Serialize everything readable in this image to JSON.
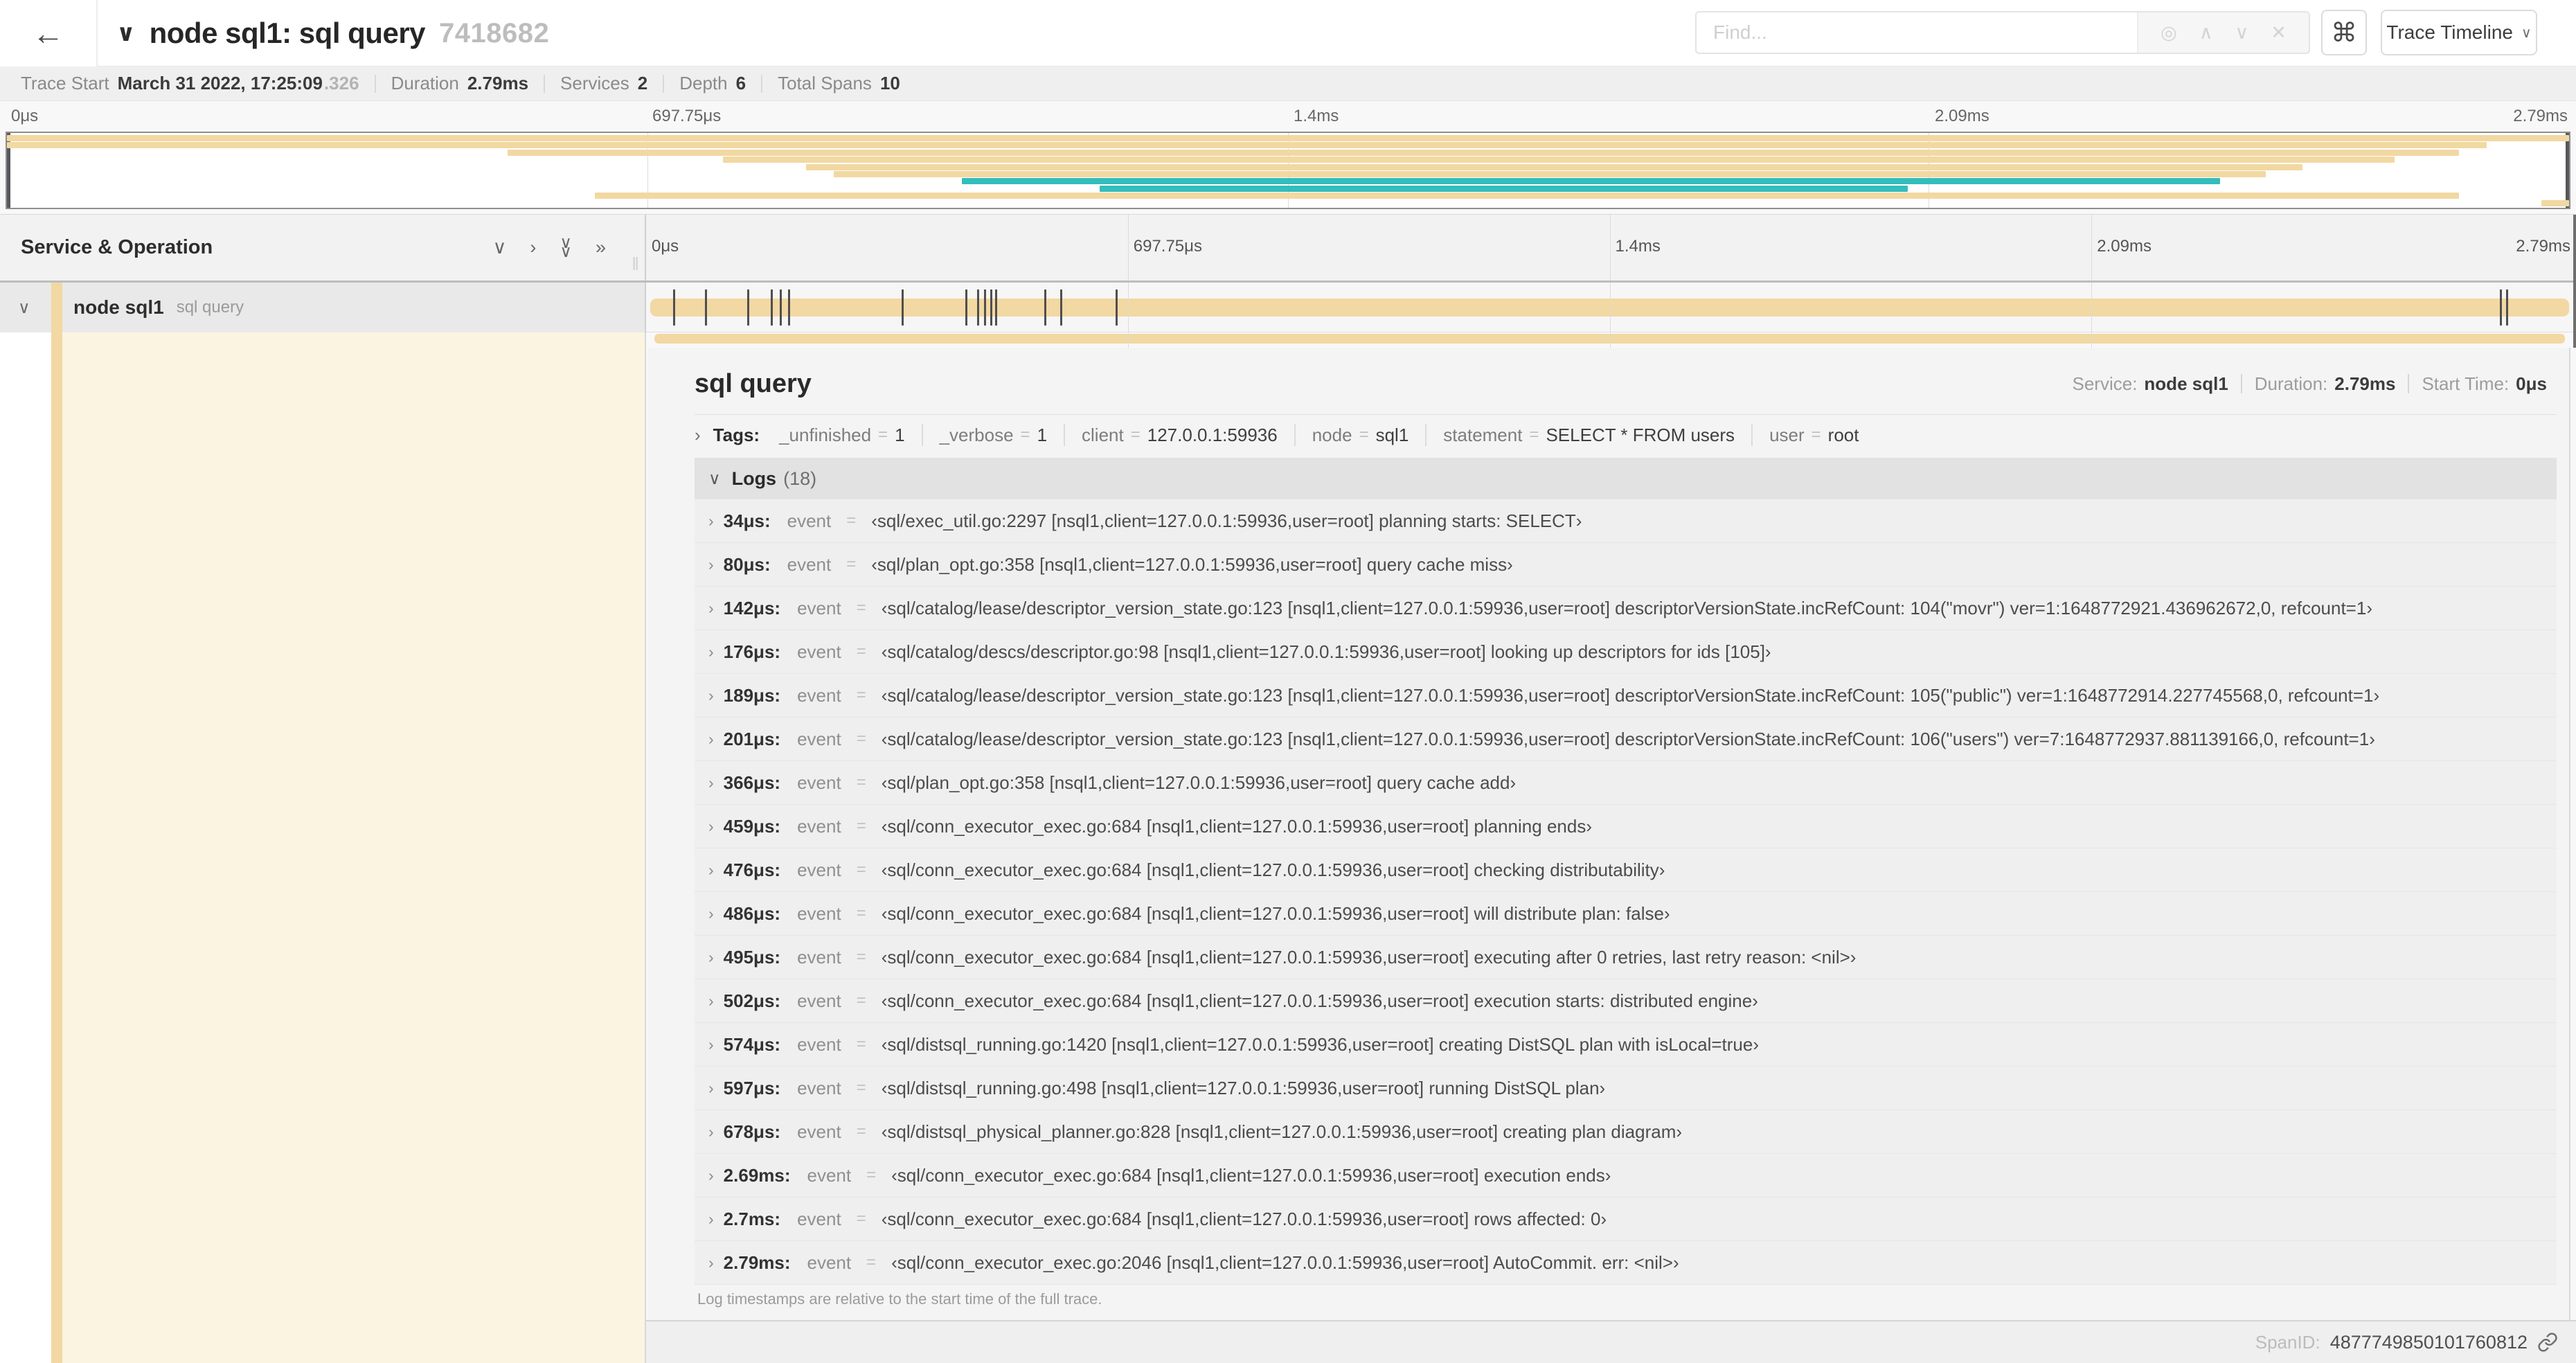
{
  "header": {
    "back_icon": "←",
    "collapse_icon": "∨",
    "title": "node sql1: sql query",
    "trace_id_short": "7418682",
    "find_placeholder": "Find...",
    "shortcut_icon": "⌘",
    "view_selector_label": "Trace Timeline",
    "view_selector_caret": "∨"
  },
  "summary": {
    "items": [
      {
        "label": "Trace Start",
        "value": "March 31 2022, 17:25:09",
        "suffix": ".326"
      },
      {
        "label": "Duration",
        "value": "2.79ms"
      },
      {
        "label": "Services",
        "value": "2"
      },
      {
        "label": "Depth",
        "value": "6"
      },
      {
        "label": "Total Spans",
        "value": "10"
      }
    ]
  },
  "minimap": {
    "axis_labels": [
      "0μs",
      "697.75μs",
      "1.4ms",
      "2.09ms",
      "2.79ms"
    ],
    "duration_ms": 2.79,
    "spans": [
      {
        "start_ms": 0.0,
        "end_ms": 2.79,
        "color": "tan"
      },
      {
        "start_ms": 0.0,
        "end_ms": 2.7,
        "color": "tan"
      },
      {
        "start_ms": 0.545,
        "end_ms": 2.67,
        "color": "tan"
      },
      {
        "start_ms": 0.78,
        "end_ms": 2.6,
        "color": "tan"
      },
      {
        "start_ms": 0.87,
        "end_ms": 2.5,
        "color": "tan"
      },
      {
        "start_ms": 0.9,
        "end_ms": 2.46,
        "color": "tan"
      },
      {
        "start_ms": 1.04,
        "end_ms": 2.41,
        "color": "teal"
      },
      {
        "start_ms": 1.19,
        "end_ms": 2.07,
        "color": "teal"
      },
      {
        "start_ms": 0.64,
        "end_ms": 2.67,
        "color": "tan"
      },
      {
        "start_ms": 2.76,
        "end_ms": 2.79,
        "color": "tan"
      }
    ]
  },
  "timeline": {
    "left_header": "Service & Operation",
    "axis_labels": [
      "0μs",
      "697.75μs",
      "1.4ms",
      "2.09ms",
      "2.79ms"
    ],
    "row": {
      "service": "node sql1",
      "operation": "sql query"
    },
    "log_marker_pcts": [
      1.22,
      2.87,
      5.09,
      6.31,
      6.77,
      7.2,
      13.12,
      16.45,
      17.06,
      17.42,
      17.74,
      17.99,
      20.57,
      21.4,
      24.3,
      96.42,
      96.77
    ]
  },
  "detail": {
    "title": "sql query",
    "meta": [
      {
        "label": "Service:",
        "value": "node sql1"
      },
      {
        "label": "Duration:",
        "value": "2.79ms"
      },
      {
        "label": "Start Time:",
        "value": "0μs"
      }
    ],
    "tags_label": "Tags:",
    "kv_separator": "=",
    "tags": [
      {
        "key": "_unfinished",
        "value": "1"
      },
      {
        "key": "_verbose",
        "value": "1"
      },
      {
        "key": "client",
        "value": "127.0.0.1:59936"
      },
      {
        "key": "node",
        "value": "sql1"
      },
      {
        "key": "statement",
        "value": "SELECT * FROM users"
      },
      {
        "key": "user",
        "value": "root"
      }
    ],
    "logs_label": "Logs",
    "logs_count": "(18)",
    "logs": [
      {
        "time": "34μs:",
        "key": "event",
        "value": "‹sql/exec_util.go:2297 [nsql1,client=127.0.0.1:59936,user=root] planning starts: SELECT›"
      },
      {
        "time": "80μs:",
        "key": "event",
        "value": "‹sql/plan_opt.go:358 [nsql1,client=127.0.0.1:59936,user=root] query cache miss›"
      },
      {
        "time": "142μs:",
        "key": "event",
        "value": "‹sql/catalog/lease/descriptor_version_state.go:123 [nsql1,client=127.0.0.1:59936,user=root] descriptorVersionState.incRefCount: 104(\"movr\") ver=1:1648772921.436962672,0, refcount=1›"
      },
      {
        "time": "176μs:",
        "key": "event",
        "value": "‹sql/catalog/descs/descriptor.go:98 [nsql1,client=127.0.0.1:59936,user=root] looking up descriptors for ids [105]›"
      },
      {
        "time": "189μs:",
        "key": "event",
        "value": "‹sql/catalog/lease/descriptor_version_state.go:123 [nsql1,client=127.0.0.1:59936,user=root] descriptorVersionState.incRefCount: 105(\"public\") ver=1:1648772914.227745568,0, refcount=1›"
      },
      {
        "time": "201μs:",
        "key": "event",
        "value": "‹sql/catalog/lease/descriptor_version_state.go:123 [nsql1,client=127.0.0.1:59936,user=root] descriptorVersionState.incRefCount: 106(\"users\") ver=7:1648772937.881139166,0, refcount=1›"
      },
      {
        "time": "366μs:",
        "key": "event",
        "value": "‹sql/plan_opt.go:358 [nsql1,client=127.0.0.1:59936,user=root] query cache add›"
      },
      {
        "time": "459μs:",
        "key": "event",
        "value": "‹sql/conn_executor_exec.go:684 [nsql1,client=127.0.0.1:59936,user=root] planning ends›"
      },
      {
        "time": "476μs:",
        "key": "event",
        "value": "‹sql/conn_executor_exec.go:684 [nsql1,client=127.0.0.1:59936,user=root] checking distributability›"
      },
      {
        "time": "486μs:",
        "key": "event",
        "value": "‹sql/conn_executor_exec.go:684 [nsql1,client=127.0.0.1:59936,user=root] will distribute plan: false›"
      },
      {
        "time": "495μs:",
        "key": "event",
        "value": "‹sql/conn_executor_exec.go:684 [nsql1,client=127.0.0.1:59936,user=root] executing after 0 retries, last retry reason: <nil>›"
      },
      {
        "time": "502μs:",
        "key": "event",
        "value": "‹sql/conn_executor_exec.go:684 [nsql1,client=127.0.0.1:59936,user=root] execution starts: distributed engine›"
      },
      {
        "time": "574μs:",
        "key": "event",
        "value": "‹sql/distsql_running.go:1420 [nsql1,client=127.0.0.1:59936,user=root] creating DistSQL plan with isLocal=true›"
      },
      {
        "time": "597μs:",
        "key": "event",
        "value": "‹sql/distsql_running.go:498 [nsql1,client=127.0.0.1:59936,user=root] running DistSQL plan›"
      },
      {
        "time": "678μs:",
        "key": "event",
        "value": "‹sql/distsql_physical_planner.go:828 [nsql1,client=127.0.0.1:59936,user=root] creating plan diagram›"
      },
      {
        "time": "2.69ms:",
        "key": "event",
        "value": "‹sql/conn_executor_exec.go:684 [nsql1,client=127.0.0.1:59936,user=root] execution ends›"
      },
      {
        "time": "2.7ms:",
        "key": "event",
        "value": "‹sql/conn_executor_exec.go:684 [nsql1,client=127.0.0.1:59936,user=root] rows affected: 0›"
      },
      {
        "time": "2.79ms:",
        "key": "event",
        "value": "‹sql/conn_executor_exec.go:2046 [nsql1,client=127.0.0.1:59936,user=root] AutoCommit. err: <nil>›"
      }
    ],
    "footer_note": "Log timestamps are relative to the start time of the full trace.",
    "span_id_label": "SpanID:",
    "span_id": "4877749850101760812"
  },
  "colors": {
    "span_tan": "#F2D8A2",
    "span_teal": "#34BDBB",
    "detail_cream": "#FBF4E0",
    "selected_row_bg": "#e9e9e9"
  }
}
